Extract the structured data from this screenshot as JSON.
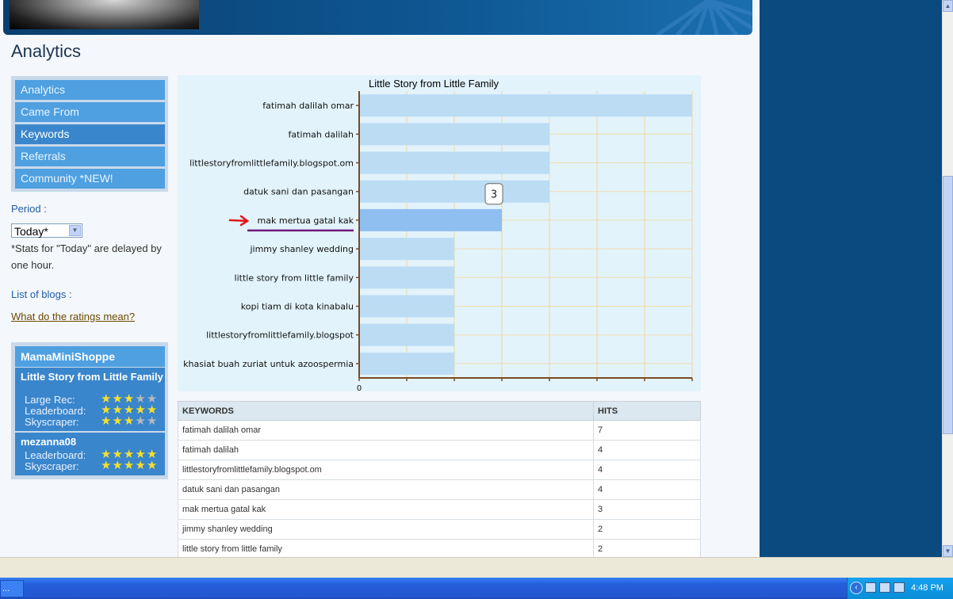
{
  "page": {
    "title": "Analytics",
    "nav": [
      {
        "label": "Analytics",
        "active": false
      },
      {
        "label": "Came From",
        "active": false
      },
      {
        "label": "Keywords",
        "active": true
      },
      {
        "label": "Referrals",
        "active": false
      },
      {
        "label": "Community *NEW!",
        "active": false
      }
    ],
    "period_label": "Period :",
    "period_value": "Today*",
    "delay_note": "*Stats for \"Today\" are delayed by one hour.",
    "blogs_label": "List of blogs :",
    "ratings_link": "What do the ratings mean?"
  },
  "blogs": {
    "header": "MamaMiniShoppe",
    "cards": [
      {
        "name": "Little Story from Little Family",
        "ratings": [
          {
            "label": "Large Rec:",
            "stars": 3
          },
          {
            "label": "Leaderboard:",
            "stars": 5
          },
          {
            "label": "Skyscraper:",
            "stars": 3
          }
        ]
      },
      {
        "name": "mezanna08",
        "ratings": [
          {
            "label": "Leaderboard:",
            "stars": 5
          },
          {
            "label": "Skyscraper:",
            "stars": 5
          }
        ]
      }
    ]
  },
  "chart_data": {
    "type": "bar",
    "orientation": "horizontal",
    "title": "Little Story from Little Family",
    "categories": [
      "fatimah dalilah omar",
      "fatimah dalilah",
      "littlestoryfromlittlefamily.blogspot.om",
      "datuk sani dan pasangan",
      "mak mertua gatal kak",
      "jimmy shanley wedding",
      "little story from little family",
      "kopi tiam di kota kinabalu",
      "littlestoryfromlittlefamily.blogspot",
      "khasiat buah zuriat untuk azoospermia"
    ],
    "values": [
      7,
      4,
      4,
      4,
      3,
      2,
      2,
      2,
      2,
      2
    ],
    "xlim": [
      0,
      7
    ],
    "x_tick_label": "0",
    "highlighted_category": "mak mertua gatal kak",
    "tooltip": "3",
    "grid": true,
    "colors": {
      "bar": "#bcdcf4",
      "highlight": "#8ebff0",
      "panel": "#e2f3fb",
      "grid": "#f3d79c",
      "axis": "#7a4a22"
    }
  },
  "table": {
    "headers": [
      "KEYWORDS",
      "HITS"
    ],
    "rows": [
      [
        "fatimah dalilah omar",
        "7"
      ],
      [
        "fatimah dalilah",
        "4"
      ],
      [
        "littlestoryfromlittlefamily.blogspot.om",
        "4"
      ],
      [
        "datuk sani dan pasangan",
        "4"
      ],
      [
        "mak mertua gatal kak",
        "3"
      ],
      [
        "jimmy shanley wedding",
        "2"
      ],
      [
        "little story from little family",
        "2"
      ]
    ]
  },
  "taskbar": {
    "item_label": "...",
    "clock": "4:48 PM"
  }
}
